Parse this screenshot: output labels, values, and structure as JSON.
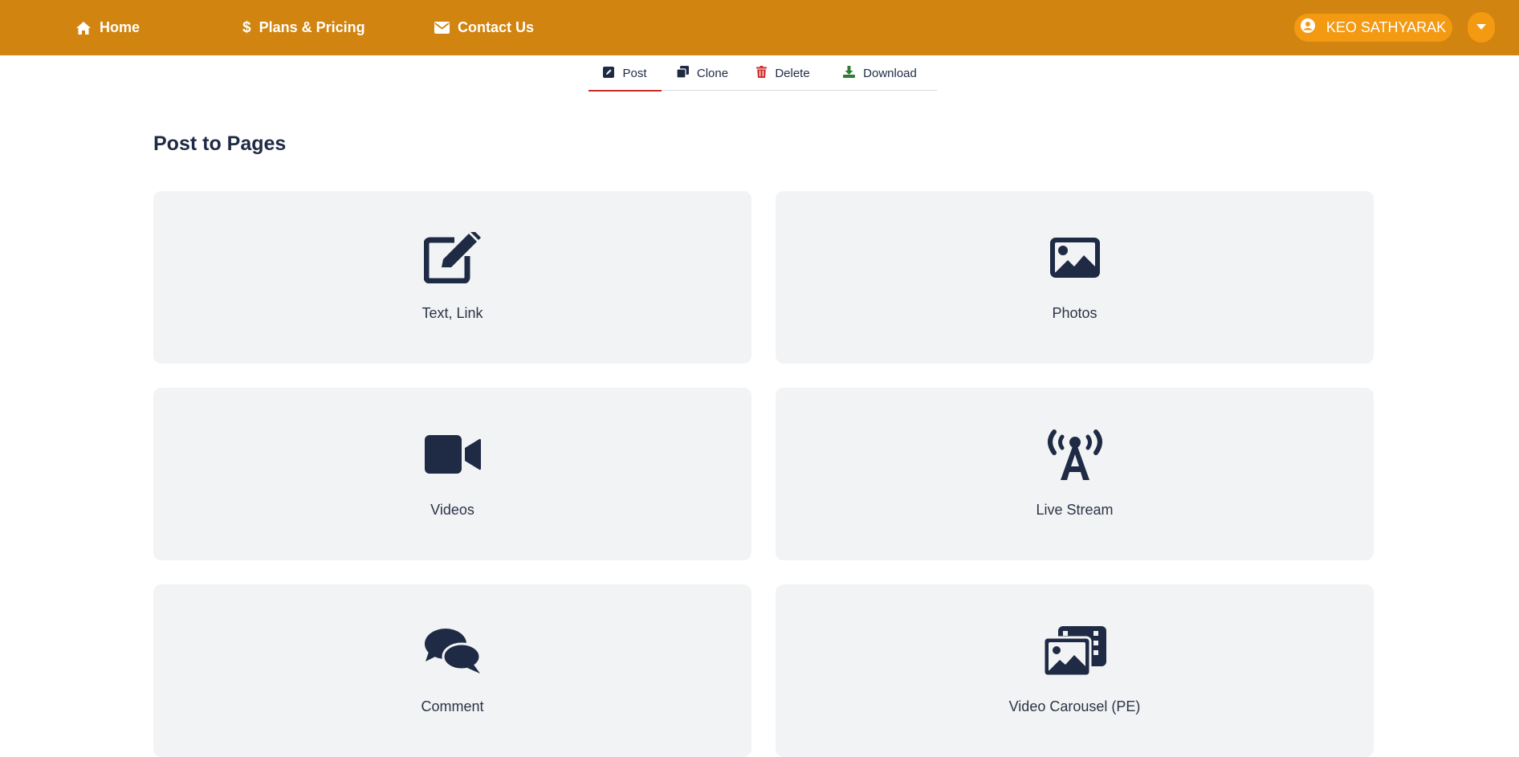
{
  "nav": {
    "home": "Home",
    "plans": "Plans & Pricing",
    "contact": "Contact Us",
    "user_name": "KEO SATHYARAK"
  },
  "tabs": [
    {
      "label": "Post",
      "icon": "edit-square-icon",
      "icon_color": "#1f2a44",
      "active": true
    },
    {
      "label": "Clone",
      "icon": "clone-icon",
      "icon_color": "#1f2a44",
      "active": false
    },
    {
      "label": "Delete",
      "icon": "trash-icon",
      "icon_color": "#d32f2f",
      "active": false
    },
    {
      "label": "Download",
      "icon": "download-icon",
      "icon_color": "#2e7d32",
      "active": false
    }
  ],
  "main": {
    "title": "Post to Pages",
    "cards": [
      {
        "label": "Text, Link",
        "icon": "edit-icon"
      },
      {
        "label": "Photos",
        "icon": "image-icon"
      },
      {
        "label": "Videos",
        "icon": "video-icon"
      },
      {
        "label": "Live Stream",
        "icon": "broadcast-tower-icon"
      },
      {
        "label": "Comment",
        "icon": "comments-icon"
      },
      {
        "label": "Video Carousel (PE)",
        "icon": "photo-film-icon"
      }
    ]
  },
  "colors": {
    "topbar": "#d1840f",
    "accent_pill": "#f39a12",
    "active_tab_underline": "#c92a2a",
    "card_bg": "#f2f3f5",
    "icon": "#1f2a44"
  }
}
